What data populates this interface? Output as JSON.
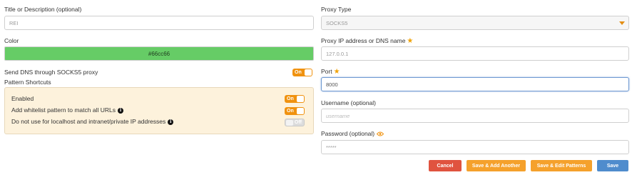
{
  "left": {
    "title_label": "Title or Description (optional)",
    "title_value": "REI",
    "color_label": "Color",
    "color_value": "#66cc66",
    "dns_label": "Send DNS through SOCKS5 proxy",
    "dns_toggle": "On",
    "patterns_label": "Pattern Shortcuts",
    "patterns": [
      {
        "label": "Enabled",
        "toggle": "On",
        "info": false
      },
      {
        "label": "Add whitelist pattern to match all URLs",
        "toggle": "On",
        "info": true
      },
      {
        "label": "Do not use for localhost and intranet/private IP addresses",
        "toggle": "Off",
        "info": true
      }
    ]
  },
  "right": {
    "proxy_type_label": "Proxy Type",
    "proxy_type_value": "SOCKS5",
    "ip_label": "Proxy IP address or DNS name",
    "ip_value": "127.0.0.1",
    "port_label": "Port",
    "port_value": "8000",
    "username_label": "Username (optional)",
    "username_placeholder": "username",
    "password_label": "Password (optional)",
    "password_value": "*****"
  },
  "buttons": {
    "cancel": "Cancel",
    "save_add_another": "Save & Add Another",
    "save_edit_patterns": "Save & Edit Patterns",
    "save": "Save"
  },
  "colors": {
    "accent": "#f0920f",
    "proxy_color": "#66cc66",
    "cancel": "#e0533f",
    "save": "#4f8ccd"
  }
}
